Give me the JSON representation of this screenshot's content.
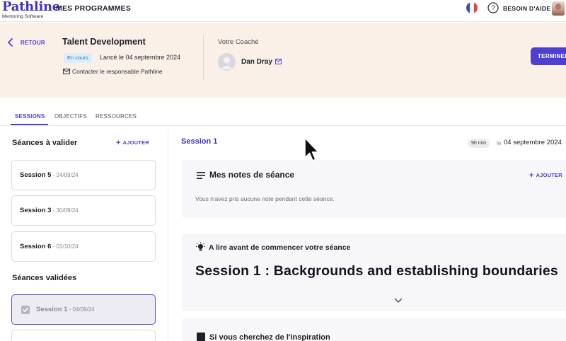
{
  "app": {
    "logo_name": "Pathline",
    "logo_sub": "Mentoring Software",
    "nav_title": "MES PROGRAMMES",
    "help_label": "BESOIN D'AIDE",
    "brand_color": "#4d3fd0"
  },
  "program": {
    "back_label": "RETOUR",
    "title": "Talent Development",
    "status": "En cours",
    "launch_text": "Lancé le 04 septembre 2024",
    "contact_label": "Contacter le responsable Pathline",
    "coach_label": "Votre Coaché",
    "coach_name": "Dan Dray",
    "finish_label": "TERMINER"
  },
  "tabs": [
    {
      "label": "SESSIONS",
      "active": true
    },
    {
      "label": "OBJECTIFS",
      "active": false
    },
    {
      "label": "RESSOURCES",
      "active": false
    }
  ],
  "to_validate": {
    "title": "Séances à valider",
    "add_label": "AJOUTER",
    "items": [
      {
        "name": "Session 5",
        "date": " - 24/09/24"
      },
      {
        "name": "Session 3",
        "date": " - 30/09/24"
      },
      {
        "name": "Session 6",
        "date": " - 01/10/24"
      }
    ]
  },
  "validated": {
    "title": "Séances validées",
    "items": [
      {
        "name": "Session 1",
        "date": " - 04/09/24"
      }
    ]
  },
  "session": {
    "title": "Session 1",
    "duration": "90 min",
    "date_prefix": "le",
    "date": "04 septembre 2024",
    "notes_title": "Mes notes de séance",
    "notes_add": "AJOUTER",
    "notes_empty": "Vous n'avez pris aucune note pendant cette séance.",
    "read_before": "A lire avant de commencer votre séance",
    "content_title": "Session 1 : Backgrounds and establishing boundaries",
    "inspiration_title": "Si vous cherchez de l'inspiration"
  }
}
